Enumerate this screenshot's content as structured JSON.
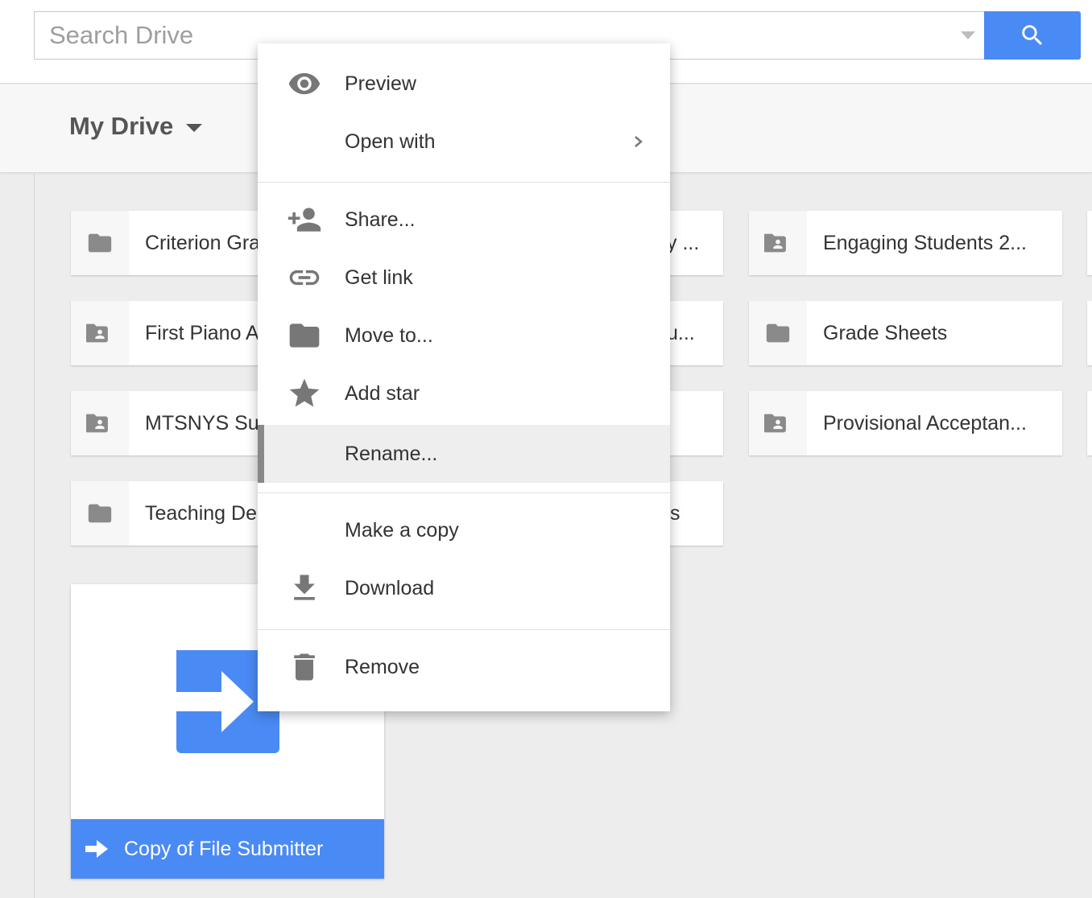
{
  "search": {
    "placeholder": "Search Drive"
  },
  "header": {
    "title": "My Drive"
  },
  "folders": [
    {
      "name": "Criterion Gra",
      "type": "folder"
    },
    {
      "name": "First Piano A",
      "type": "shared-folder"
    },
    {
      "name": "MTSNYS Su",
      "type": "shared-folder"
    },
    {
      "name": "Teaching De",
      "type": "folder"
    }
  ],
  "middle_fragments": [
    "y ...",
    "u...",
    "",
    "s"
  ],
  "right_folders": [
    {
      "name": "Engaging Students 2...",
      "type": "shared-folder"
    },
    {
      "name": "Grade Sheets",
      "type": "folder"
    },
    {
      "name": "Provisional Acceptan...",
      "type": "shared-folder"
    }
  ],
  "file_card": {
    "name": "Copy of File Submitter",
    "icon": "arrow-right-icon"
  },
  "context_menu": {
    "items": [
      {
        "label": "Preview",
        "icon": "eye-icon"
      },
      {
        "label": "Open with",
        "icon": "",
        "submenu": true
      },
      {
        "label": "Share...",
        "icon": "person-add-icon"
      },
      {
        "label": "Get link",
        "icon": "link-icon"
      },
      {
        "label": "Move to...",
        "icon": "folder-icon"
      },
      {
        "label": "Add star",
        "icon": "star-icon"
      },
      {
        "label": "Rename...",
        "icon": "",
        "highlighted": true
      },
      {
        "label": "Make a copy",
        "icon": ""
      },
      {
        "label": "Download",
        "icon": "download-icon"
      },
      {
        "label": "Remove",
        "icon": "trash-icon"
      }
    ]
  },
  "colors": {
    "accent": "#4a8af4",
    "icon_gray": "#777777",
    "menu_highlight": "#eeeeee"
  }
}
